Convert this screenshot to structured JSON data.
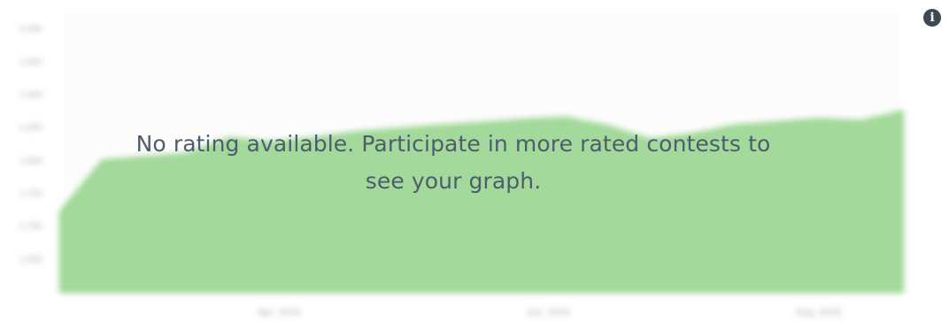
{
  "empty_state": {
    "message": "No rating available. Participate in more rated contests to see your graph."
  },
  "info_button": {
    "icon": "info-icon",
    "glyph": "i"
  },
  "colors": {
    "area_fill": "#a3d99a",
    "area_stroke": "#8fd184",
    "grid": "#e6e6e6",
    "message_text": "#4c5d6e",
    "icon_bg": "#3d4852"
  },
  "chart_data": {
    "type": "area",
    "grid": true,
    "x_ticks": [
      "Apr, 2016",
      "Jun, 2016",
      "Aug, 2016"
    ],
    "y_ticks": [
      "2,000",
      "1,950",
      "1,900",
      "1,850",
      "1,800",
      "1,750",
      "1,700",
      "1,650"
    ],
    "ylim": [
      1600,
      2025
    ],
    "x": [
      0,
      1,
      2,
      3,
      4,
      5,
      6,
      7,
      8,
      9,
      10,
      11,
      12,
      13,
      14,
      15,
      16,
      17,
      18,
      19,
      20
    ],
    "values": [
      1722,
      1800,
      1805,
      1810,
      1834,
      1828,
      1834,
      1843,
      1848,
      1853,
      1857,
      1862,
      1865,
      1852,
      1832,
      1840,
      1853,
      1858,
      1863,
      1860,
      1875
    ]
  }
}
